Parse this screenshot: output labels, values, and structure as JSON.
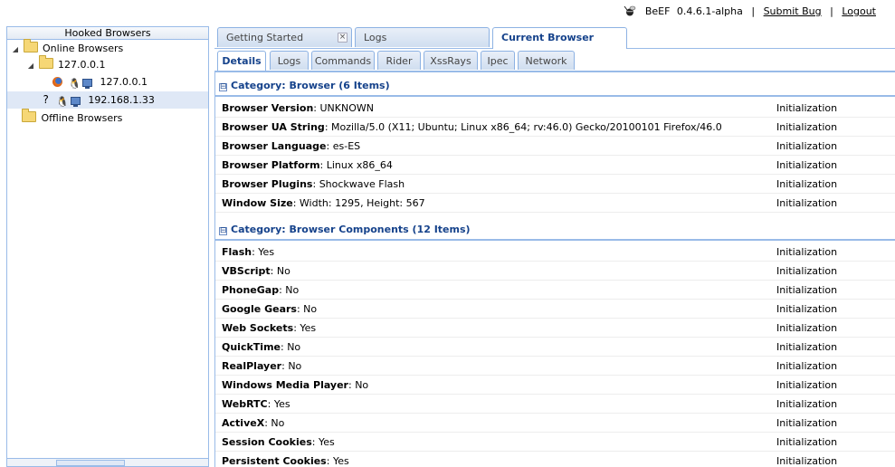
{
  "header": {
    "product": "BeEF",
    "version": "0.4.6.1-alpha",
    "separator": "|",
    "submit_bug": "Submit Bug",
    "logout": "Logout"
  },
  "sidebar": {
    "title": "Hooked Browsers",
    "online": "Online Browsers",
    "online_group": "127.0.0.1",
    "online_browser": "127.0.0.1",
    "unknown_browser": "192.168.1.33",
    "offline": "Offline Browsers"
  },
  "main_tabs": [
    "Getting Started",
    "Logs",
    "Current Browser"
  ],
  "sub_tabs": [
    "Details",
    "Logs",
    "Commands",
    "Rider",
    "XssRays",
    "Ipec",
    "Network"
  ],
  "icons": {
    "collapse": "⊟",
    "close": "×",
    "tux": "penguin",
    "question": "?"
  },
  "categories": [
    {
      "title": "Category: Browser (6 Items)",
      "rows": [
        {
          "key": "Browser Version",
          "value": "UNKNOWN",
          "status": "Initialization"
        },
        {
          "key": "Browser UA String",
          "value": "Mozilla/5.0 (X11; Ubuntu; Linux x86_64; rv:46.0) Gecko/20100101 Firefox/46.0",
          "status": "Initialization"
        },
        {
          "key": "Browser Language",
          "value": "es-ES",
          "status": "Initialization"
        },
        {
          "key": "Browser Platform",
          "value": "Linux x86_64",
          "status": "Initialization"
        },
        {
          "key": "Browser Plugins",
          "value": "Shockwave Flash",
          "status": "Initialization"
        },
        {
          "key": "Window Size",
          "value": "Width: 1295, Height: 567",
          "status": "Initialization"
        }
      ]
    },
    {
      "title": "Category: Browser Components (12 Items)",
      "rows": [
        {
          "key": "Flash",
          "value": "Yes",
          "status": "Initialization"
        },
        {
          "key": "VBScript",
          "value": "No",
          "status": "Initialization"
        },
        {
          "key": "PhoneGap",
          "value": "No",
          "status": "Initialization"
        },
        {
          "key": "Google Gears",
          "value": "No",
          "status": "Initialization"
        },
        {
          "key": "Web Sockets",
          "value": "Yes",
          "status": "Initialization"
        },
        {
          "key": "QuickTime",
          "value": "No",
          "status": "Initialization"
        },
        {
          "key": "RealPlayer",
          "value": "No",
          "status": "Initialization"
        },
        {
          "key": "Windows Media Player",
          "value": "No",
          "status": "Initialization"
        },
        {
          "key": "WebRTC",
          "value": "Yes",
          "status": "Initialization"
        },
        {
          "key": "ActiveX",
          "value": "No",
          "status": "Initialization"
        },
        {
          "key": "Session Cookies",
          "value": "Yes",
          "status": "Initialization"
        },
        {
          "key": "Persistent Cookies",
          "value": "Yes",
          "status": "Initialization"
        }
      ]
    }
  ]
}
